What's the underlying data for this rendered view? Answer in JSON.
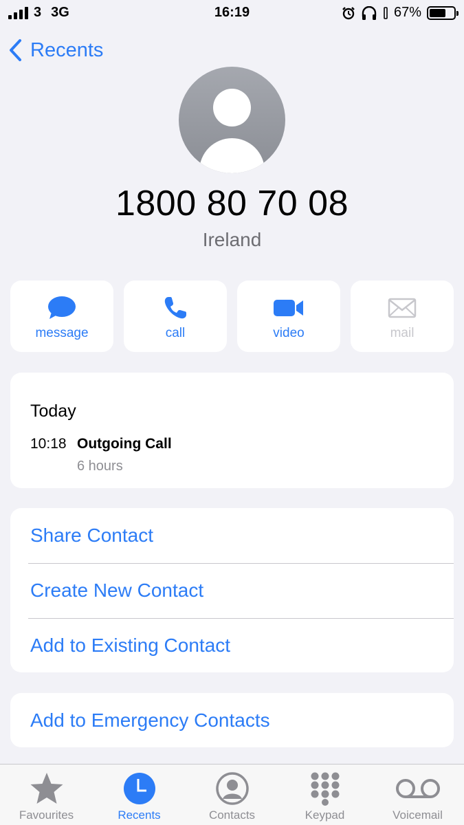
{
  "status_bar": {
    "carrier": "3",
    "network": "3G",
    "time": "16:19",
    "battery": "67%",
    "battery_level": 0.67,
    "icons": [
      "signal-icon",
      "alarm-icon",
      "headphones-icon",
      "battery-icon"
    ]
  },
  "nav": {
    "back_label": "Recents"
  },
  "contact": {
    "number": "1800 80 70 08",
    "region": "Ireland"
  },
  "actions": [
    {
      "label": "message",
      "icon": "message-icon",
      "enabled": true
    },
    {
      "label": "call",
      "icon": "phone-icon",
      "enabled": true
    },
    {
      "label": "video",
      "icon": "video-icon",
      "enabled": true
    },
    {
      "label": "mail",
      "icon": "mail-icon",
      "enabled": false
    }
  ],
  "history": {
    "day": "Today",
    "time": "10:18",
    "type": "Outgoing Call",
    "duration": "6 hours"
  },
  "options": [
    "Share Contact",
    "Create New Contact",
    "Add to Existing Contact"
  ],
  "emergency": "Add to Emergency Contacts",
  "tabs": [
    {
      "label": "Favourites",
      "icon": "star-icon",
      "active": false
    },
    {
      "label": "Recents",
      "icon": "clock-icon",
      "active": true
    },
    {
      "label": "Contacts",
      "icon": "person-circle-icon",
      "active": false
    },
    {
      "label": "Keypad",
      "icon": "keypad-icon",
      "active": false
    },
    {
      "label": "Voicemail",
      "icon": "voicemail-icon",
      "active": false
    }
  ],
  "colors": {
    "accent": "#2c7cf6",
    "background": "#f2f2f7",
    "inactive": "#8e8e93"
  }
}
